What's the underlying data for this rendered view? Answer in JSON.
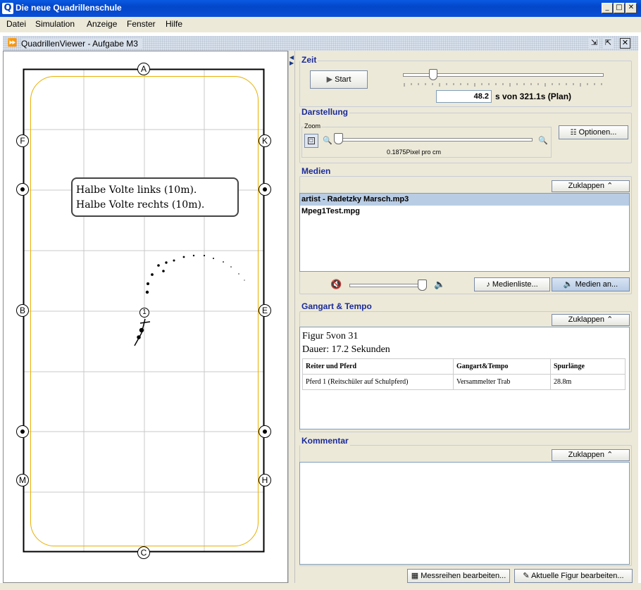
{
  "window": {
    "title": "Die neue Quadrillenschule",
    "logo_letter": "Q",
    "min": "_",
    "max": "□",
    "close": "✕"
  },
  "menubar": [
    "Datei",
    "Simulation",
    "Anzeige",
    "Fenster",
    "Hilfe"
  ],
  "internal_frame": {
    "title": "QuadrillenViewer - Aufgabe M3"
  },
  "arena": {
    "letters": {
      "top": "A",
      "bottom": "C",
      "left": [
        "F",
        "B",
        "M"
      ],
      "right": [
        "K",
        "E",
        "H"
      ]
    },
    "rider_label": "1",
    "callout": [
      "Halbe Volte links (10m).",
      "Halbe Volte rechts (10m)."
    ]
  },
  "zeit": {
    "title": "Zeit",
    "start_label": "Start",
    "slider_fraction": 0.15,
    "time_value": "48.2",
    "time_suffix": "s von 321.1s (Plan)"
  },
  "darstellung": {
    "title": "Darstellung",
    "zoom_label": "Zoom",
    "zoom_text": "0.1875Pixel pro cm",
    "options_label": "Optionen..."
  },
  "medien": {
    "title": "Medien",
    "collapse_label": "Zuklappen",
    "items": [
      "artist - Radetzky Marsch.mp3",
      "Mpeg1Test.mpg"
    ],
    "selected_index": 0,
    "volume_fraction": 0.85,
    "medienliste_label": "Medienliste...",
    "medien_an_label": "Medien an..."
  },
  "gangart": {
    "title": "Gangart & Tempo",
    "collapse_label": "Zuklappen",
    "figur": "Figur 5von 31",
    "dauer": "Dauer: 17.2 Sekunden",
    "headers": [
      "Reiter und Pferd",
      "Gangart&Tempo",
      "Spurlänge"
    ],
    "rows": [
      [
        "Pferd 1 (Reitschüler auf Schulpferd)",
        "Versammelter Trab",
        "28.8m"
      ]
    ]
  },
  "kommentar": {
    "title": "Kommentar",
    "collapse_label": "Zuklappen"
  },
  "bottom_buttons": {
    "messreihen": "Messreihen bearbeiten...",
    "figur": "Aktuelle Figur bearbeiten..."
  },
  "colors": {
    "accent": "#0a5ae2",
    "section_title": "#1a2a9a",
    "track_line": "#e8b000",
    "selection": "#b8cce4"
  }
}
